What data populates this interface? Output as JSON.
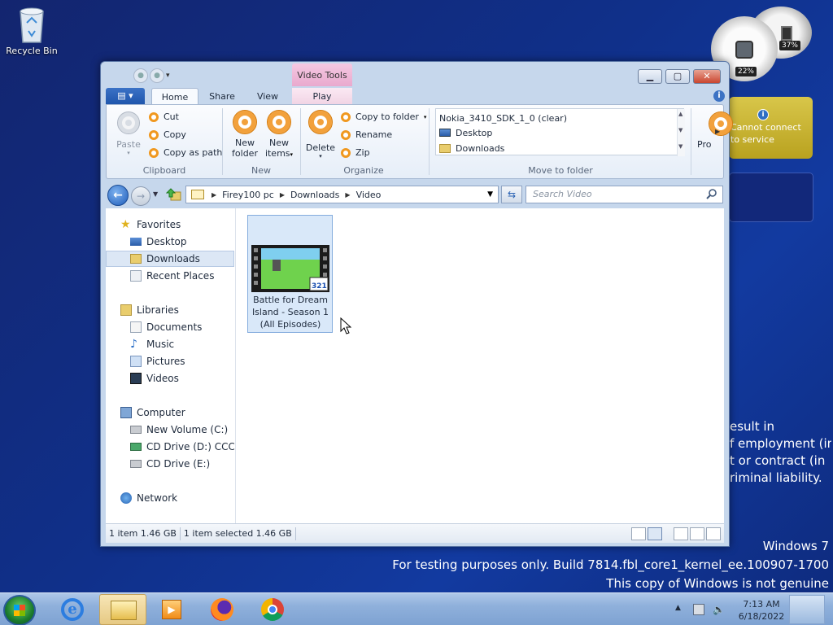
{
  "desktop": {
    "recycle_bin_label": "Recycle Bin",
    "gadgets": {
      "cpu_percent": "22%",
      "memory_percent": "37%",
      "info_line1": "Cannot connect",
      "info_line2": "to service"
    },
    "background_text": [
      "esult in",
      "f employment (in",
      "t or contract (in",
      "riminal liability."
    ]
  },
  "watermark": {
    "line1": "Windows 7",
    "line2": "For testing purposes only. Build 7814.fbl_core1_kernel_ee.100907-1700",
    "line3": "This copy of Windows is not genuine"
  },
  "window": {
    "contextual_tab_group": "Video Tools",
    "ribbon_tabs": {
      "home": "Home",
      "share": "Share",
      "view": "View",
      "play": "Play"
    },
    "clipboard": {
      "paste": "Paste",
      "cut": "Cut",
      "copy": "Copy",
      "copy_as_path": "Copy as path",
      "group_label": "Clipboard"
    },
    "new_group": {
      "new_folder_line1": "New",
      "new_folder_line2": "folder",
      "new_items_line1": "New",
      "new_items_line2": "items",
      "group_label": "New"
    },
    "organize": {
      "delete": "Delete",
      "copy_to_folder": "Copy to folder",
      "rename": "Rename",
      "zip": "Zip",
      "group_label": "Organize"
    },
    "move_to": {
      "items": [
        "Nokia_3410_SDK_1_0 (clear)",
        "Desktop",
        "Downloads"
      ],
      "group_label": "Move to folder",
      "overflow_label": "Pro"
    },
    "address": {
      "crumbs": [
        "Firey100 pc",
        "Downloads",
        "Video"
      ],
      "search_placeholder": "Search Video"
    },
    "nav": {
      "favorites": "Favorites",
      "desktop": "Desktop",
      "downloads": "Downloads",
      "recent_places": "Recent Places",
      "libraries": "Libraries",
      "documents": "Documents",
      "music": "Music",
      "pictures": "Pictures",
      "videos": "Videos",
      "computer": "Computer",
      "drive_c": "New Volume (C:)",
      "drive_d": "CD Drive (D:) CCCOI",
      "drive_e": "CD Drive (E:)",
      "network": "Network"
    },
    "files": [
      {
        "line1": "Battle for Dream",
        "line2": "Island - Season 1",
        "line3": "(All Episodes)"
      }
    ],
    "status": {
      "items": "1 item  1.46 GB",
      "selected": "1 item selected  1.46 GB"
    }
  },
  "taskbar": {
    "time": "7:13 AM",
    "date": "6/18/2022"
  }
}
